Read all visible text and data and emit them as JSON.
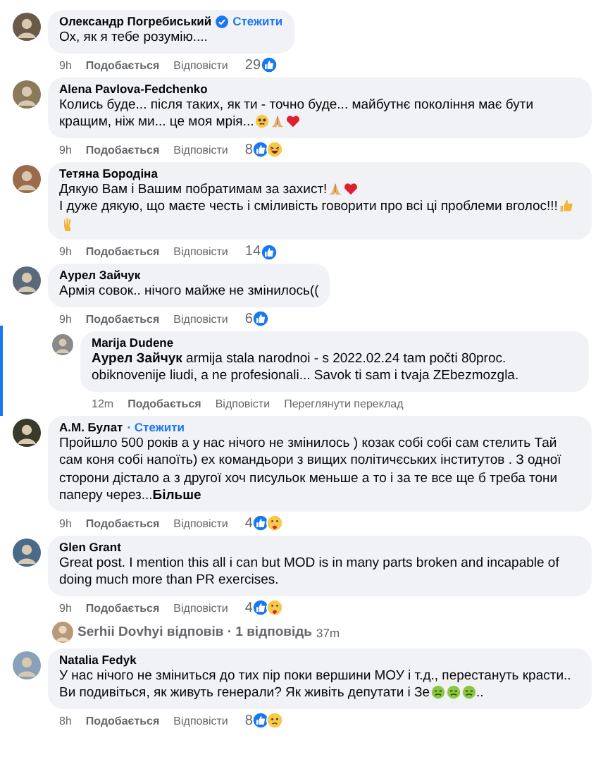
{
  "comments": [
    {
      "kind": "comment",
      "author": "Олександр Погребиський",
      "verified": true,
      "follow": "Стежити",
      "text": "Ох, як я тебе розумію....",
      "time": "9h",
      "like": "Подобається",
      "reply": "Відповісти",
      "count": "29",
      "reactions": [
        {
          "kind": "like"
        }
      ]
    },
    {
      "kind": "comment",
      "author": "Alena Pavlova-Fedchenko",
      "text": "Колись буде... після таких, як ти - точно буде... майбутнє покоління має бути кращим, ніж ми... це моя мрія...",
      "emojis": [
        {
          "kind": "tearful"
        },
        {
          "kind": "pray"
        },
        {
          "kind": "heart"
        }
      ],
      "time": "9h",
      "like": "Подобається",
      "reply": "Відповісти",
      "count": "8",
      "reactions": [
        {
          "kind": "like"
        },
        {
          "kind": "haha"
        }
      ]
    },
    {
      "kind": "comment",
      "author": "Тетяна Бородіна",
      "text": "Дякую Вам і Вашим побратимам за захист!",
      "emojis": [
        {
          "kind": "pray"
        },
        {
          "kind": "heart"
        }
      ],
      "text2": "І дуже дякую, що маєте честь і сміливість говорити про всі ці проблеми вголос!!!",
      "emojis2": [
        {
          "kind": "thumbs"
        },
        {
          "kind": "victory"
        }
      ],
      "time": "9h",
      "like": "Подобається",
      "reply": "Відповісти",
      "count": "14",
      "reactions": [
        {
          "kind": "like"
        }
      ]
    },
    {
      "kind": "comment",
      "author": "Аурел Зайчук",
      "text": "Армія совок.. нічого майже не змінилось((",
      "time": "9h",
      "like": "Подобається",
      "reply": "Відповісти",
      "count": "6",
      "reactions": [
        {
          "kind": "like"
        }
      ]
    },
    {
      "kind": "reply",
      "author": "Marija Dudene",
      "text": "**Аурел Зайчук** armija stala narodnoi - s 2022.02.24 tam počti 80proc. obiknovenije liudi, a ne profesionali... Savok ti sam i tvaja ZEbezmozgla.",
      "time": "12m",
      "like": "Подобається",
      "reply": "Відповісти",
      "translate": "Переглянути переклад"
    },
    {
      "kind": "comment",
      "author": "А.М. Булат",
      "follow": "· Стежити",
      "text": "Пройшло 500 років а у нас нічого не змінилось ) козак собі собі сам стелить Тай сам коня собі напоїть) ех командьори з вищих політичєських інститутов . З одної сторони дістало а з другої хоч писульок меньше а то і за те все ще б треба тони паперу через...",
      "more": "Більше",
      "time": "9h",
      "like": "Подобається",
      "reply": "Відповісти",
      "count": "4",
      "reactions": [
        {
          "kind": "like"
        },
        {
          "kind": "care"
        }
      ]
    },
    {
      "kind": "comment",
      "author": "Glen Grant",
      "text": "Great post. I mention this all i can but MOD is in many parts broken and incapable of doing much more than PR exercises.",
      "time": "9h",
      "like": "Подобається",
      "reply": "Відповісти",
      "count": "4",
      "reactions": [
        {
          "kind": "like"
        },
        {
          "kind": "care"
        }
      ]
    },
    {
      "kind": "replies",
      "label": "Serhii Dovhyi відповів · 1 відповідь",
      "time": "37m"
    },
    {
      "kind": "comment",
      "author": "Natalia Fedyk",
      "text": "У нас нічого не зміниться до тих пір поки вершини МОУ і т.д., перестануть красти.. Ви подивіться, як живуть генерали? Як живіть депутати і Зе",
      "emojis": [
        {
          "kind": "sick"
        },
        {
          "kind": "sick"
        },
        {
          "kind": "sick"
        }
      ],
      "tail": "..",
      "time": "8h",
      "like": "Подобається",
      "reply": "Відповісти",
      "count": "8",
      "reactions": [
        {
          "kind": "like"
        },
        {
          "kind": "sad"
        }
      ]
    }
  ]
}
